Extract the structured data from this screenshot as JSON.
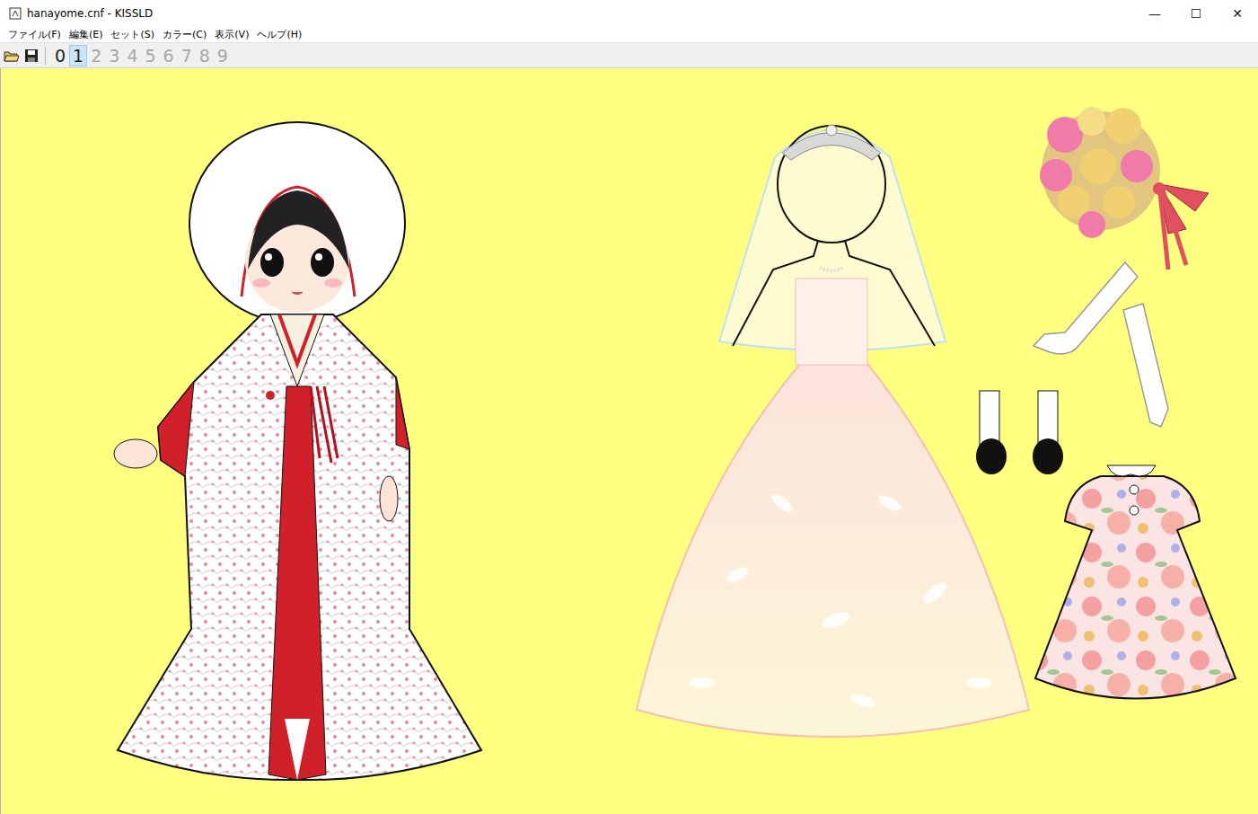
{
  "window": {
    "title": "hanayome.cnf - KISSLD",
    "controls": [
      "—",
      "☐",
      "✕"
    ]
  },
  "menu": [
    "ファイル(F)",
    "編集(E)",
    "セット(S)",
    "カラー(C)",
    "表示(V)",
    "ヘルプ(H)"
  ],
  "toolbar": {
    "sets": [
      {
        "label": "0",
        "selected": false,
        "disabled": false
      },
      {
        "label": "1",
        "selected": true,
        "disabled": false
      },
      {
        "label": "2",
        "selected": false,
        "disabled": true
      },
      {
        "label": "3",
        "selected": false,
        "disabled": true
      },
      {
        "label": "4",
        "selected": false,
        "disabled": true
      },
      {
        "label": "5",
        "selected": false,
        "disabled": true
      },
      {
        "label": "6",
        "selected": false,
        "disabled": true
      },
      {
        "label": "7",
        "selected": false,
        "disabled": true
      },
      {
        "label": "8",
        "selected": false,
        "disabled": true
      },
      {
        "label": "9",
        "selected": false,
        "disabled": true
      }
    ]
  }
}
